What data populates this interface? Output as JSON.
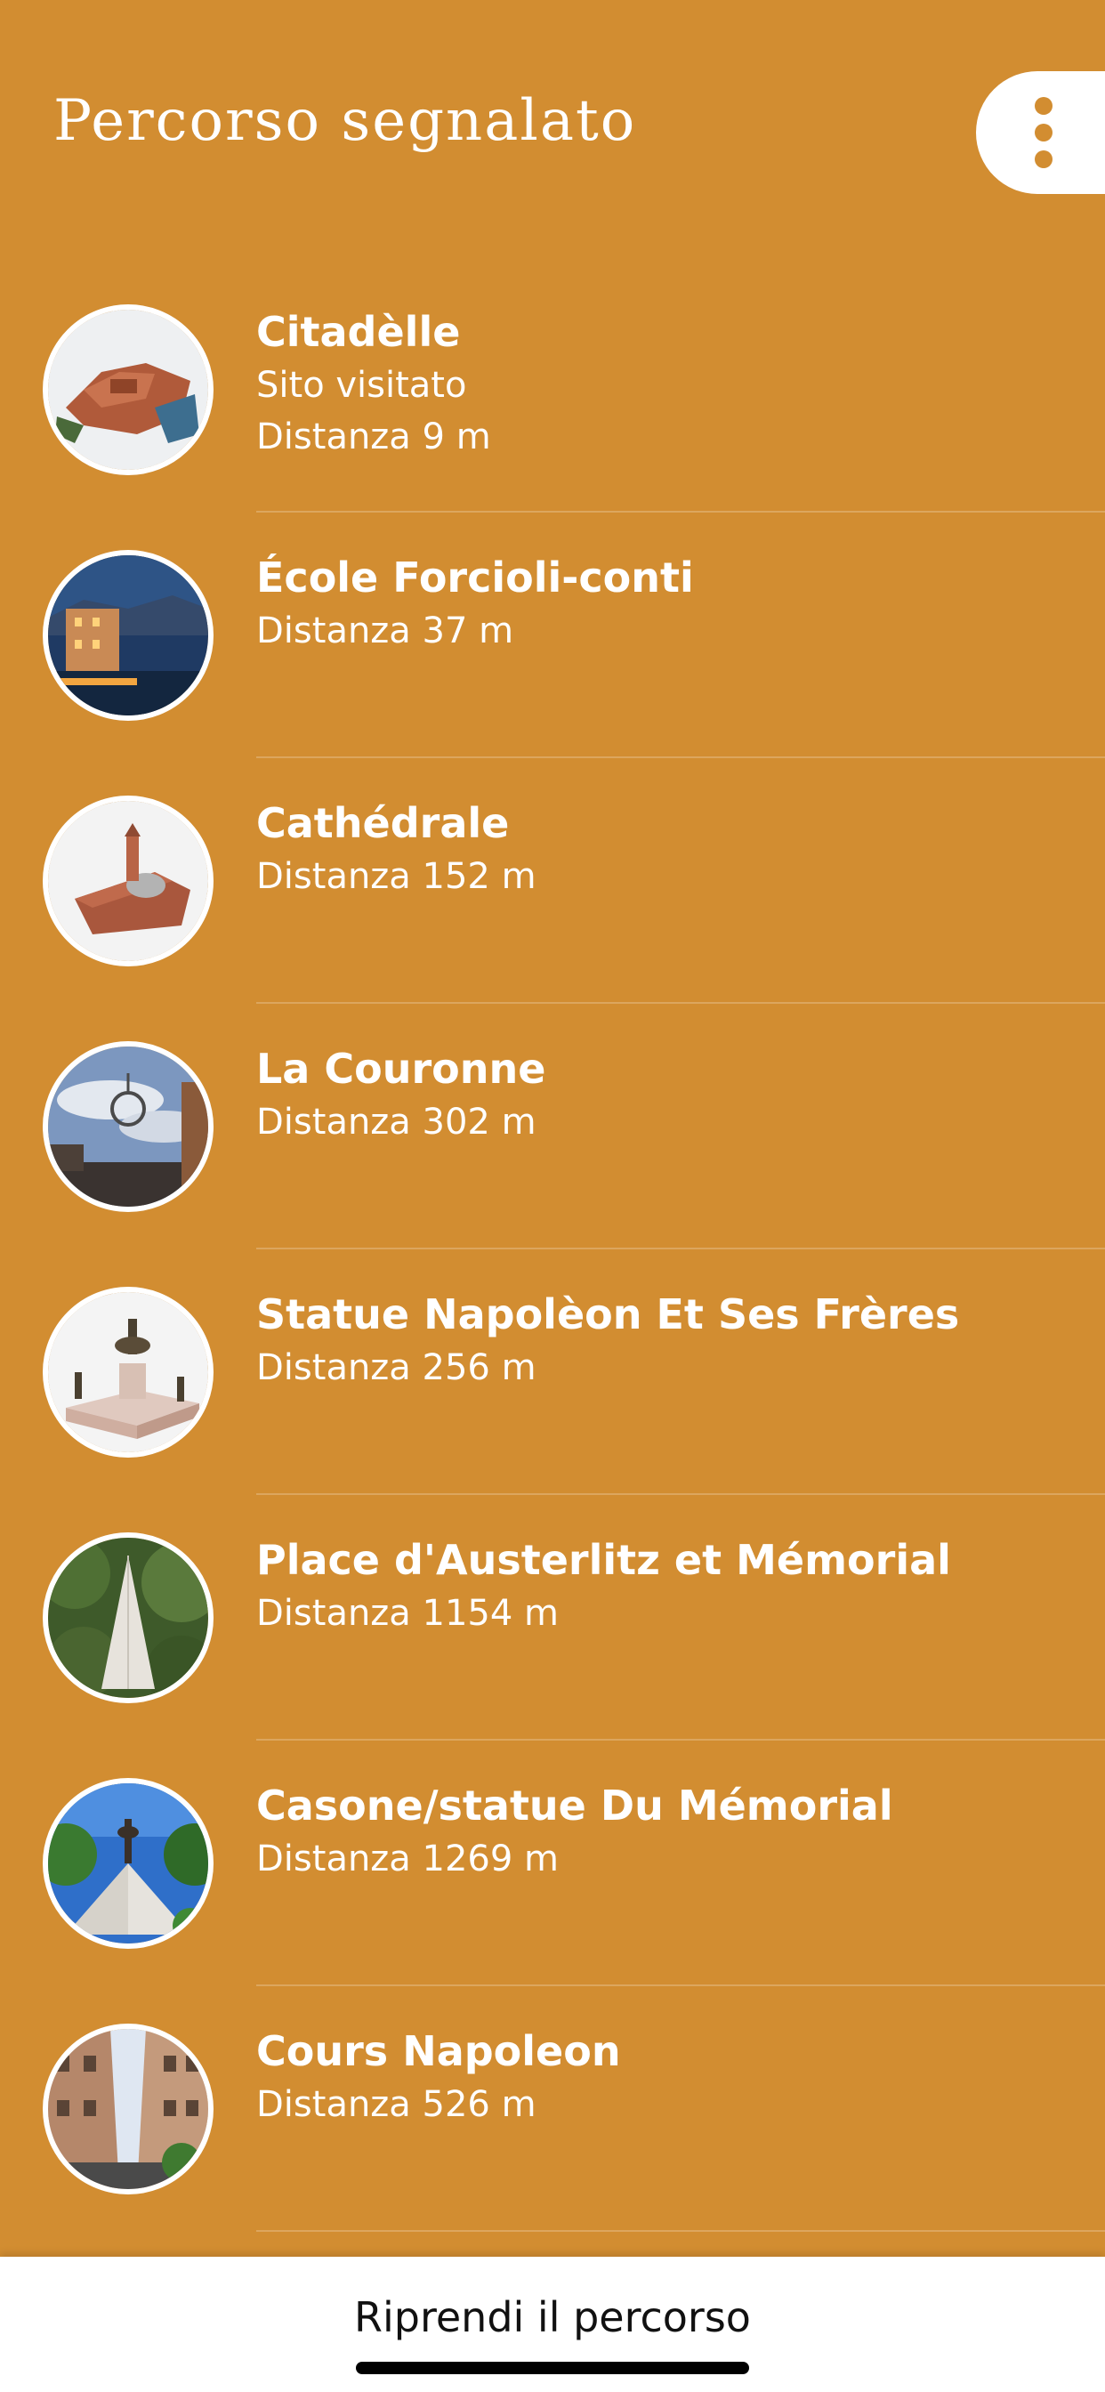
{
  "header": {
    "title": "Percorso segnalato",
    "menu_icon": "more-vertical-icon"
  },
  "poi_list": [
    {
      "name": "Citadèlle",
      "status": "Sito visitato",
      "distance": "Distanza 9 m"
    },
    {
      "name": "École Forcioli-conti",
      "distance": "Distanza 37 m"
    },
    {
      "name": "Cathédrale",
      "distance": "Distanza 152 m"
    },
    {
      "name": "La Couronne",
      "distance": "Distanza 302 m"
    },
    {
      "name": "Statue Napolèon Et Ses Frères",
      "distance": "Distanza 256 m"
    },
    {
      "name": "Place d'Austerlitz et Mémorial",
      "distance": "Distanza 1154 m"
    },
    {
      "name": "Casone/statue Du Mémorial",
      "distance": "Distanza 1269 m"
    },
    {
      "name": "Cours Napoleon",
      "distance": "Distanza 526 m"
    }
  ],
  "footer": {
    "resume_label": "Riprendi il percorso"
  },
  "colors": {
    "background": "#D28D31",
    "text": "#FFFFFF",
    "footer_background": "#FFFFFF"
  }
}
